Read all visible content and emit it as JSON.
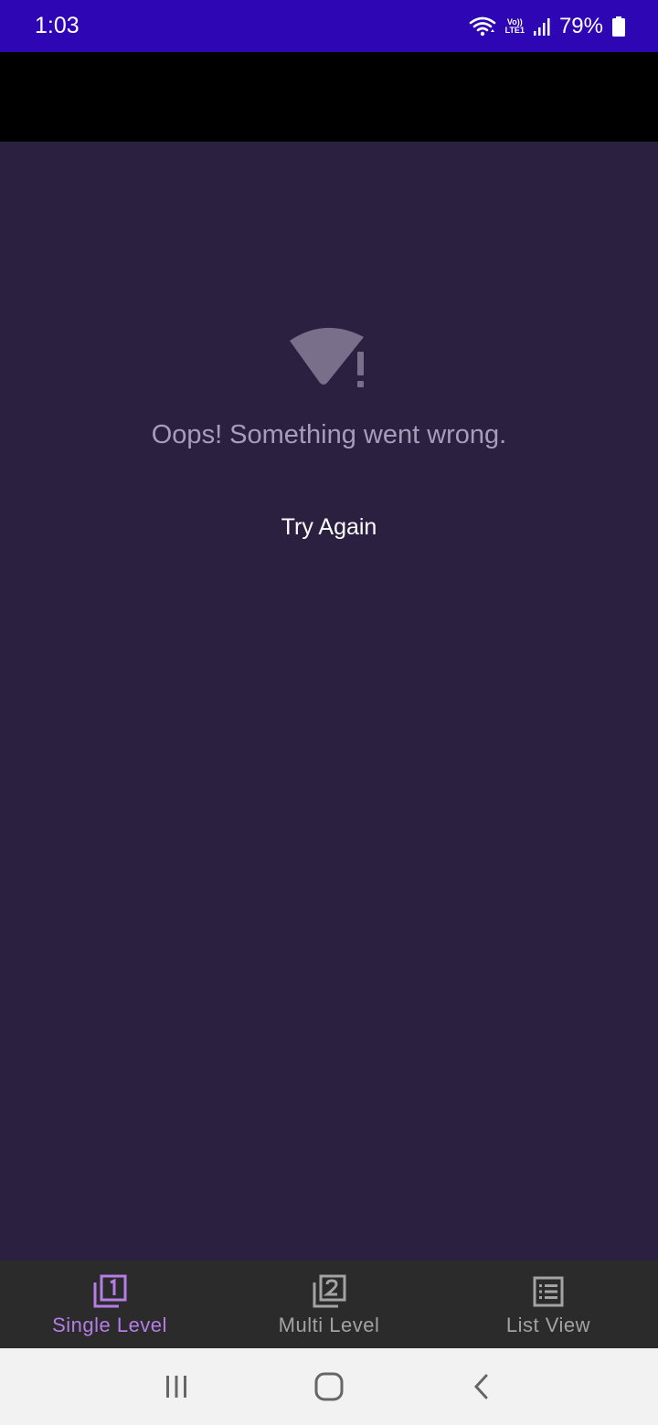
{
  "status_bar": {
    "time": "1:03",
    "network_label_top": "Vo))",
    "network_label_bottom": "LTE1",
    "battery": "79%",
    "icons": [
      "wifi-icon",
      "signal-icon",
      "battery-icon"
    ]
  },
  "error": {
    "icon": "wifi-off-alert-icon",
    "message": "Oops! Something went wrong.",
    "retry_label": "Try Again"
  },
  "bottom_nav": {
    "items": [
      {
        "label": "Single Level",
        "icon": "filter-1-icon",
        "active": true
      },
      {
        "label": "Multi Level",
        "icon": "filter-2-icon",
        "active": false
      },
      {
        "label": "List View",
        "icon": "list-view-icon",
        "active": false
      }
    ]
  },
  "system_nav": {
    "icons": [
      "recent-apps-icon",
      "home-icon",
      "back-icon"
    ]
  },
  "colors": {
    "status_bar": "#2f06b3",
    "toolbar": "#000000",
    "background": "#2b2040",
    "bottom_nav": "#2b2b2b",
    "active_accent": "#b57de6",
    "inactive": "#a3a3a3",
    "error_text": "#a89db8"
  }
}
